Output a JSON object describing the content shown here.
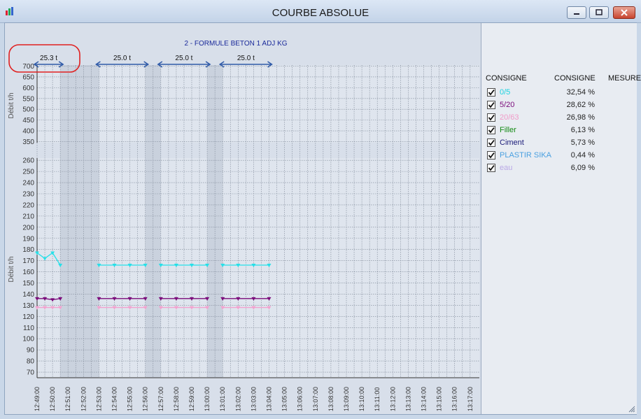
{
  "window": {
    "title": "COURBE ABSOLUE"
  },
  "chart": {
    "title": "2 - FORMULE BETON 1 ADJ KG",
    "top_axis_label": "Débit t/h",
    "bottom_axis_label": "Débit t/h",
    "top_ticks": [
      "350",
      "400",
      "450",
      "500",
      "550",
      "600",
      "650",
      "700"
    ],
    "bottom_ticks": [
      "70",
      "80",
      "90",
      "100",
      "110",
      "120",
      "130",
      "140",
      "150",
      "160",
      "170",
      "180",
      "190",
      "200",
      "210",
      "220",
      "230",
      "240",
      "250",
      "260"
    ],
    "time_labels": [
      "12:49:00",
      "12:50:00",
      "12:51:00",
      "12:52:00",
      "12:53:00",
      "12:54:00",
      "12:55:00",
      "12:56:00",
      "12:57:00",
      "12:58:00",
      "12:59:00",
      "13:00:00",
      "13:01:00",
      "13:02:00",
      "13:03:00",
      "13:04:00",
      "13:05:00",
      "13:06:00",
      "13:07:00",
      "13:08:00",
      "13:09:00",
      "13:10:00",
      "13:11:00",
      "13:12:00",
      "13:13:00",
      "13:14:00",
      "13:15:00",
      "13:16:00",
      "13:17:00"
    ],
    "batches": [
      {
        "label": "25.3 t",
        "start": "12:49:00",
        "end": "12:50:30",
        "highlighted": true
      },
      {
        "label": "25.0 t",
        "start": "12:53:00",
        "end": "12:56:00"
      },
      {
        "label": "25.0 t",
        "start": "12:57:00",
        "end": "13:00:00"
      },
      {
        "label": "25.0 t",
        "start": "13:01:00",
        "end": "13:04:00"
      }
    ],
    "shaded_spans": [
      [
        "12:50:30",
        "12:53:00"
      ],
      [
        "12:56:00",
        "12:57:00"
      ],
      [
        "13:00:00",
        "13:01:00"
      ]
    ],
    "annotation_color": "#e02020",
    "arrow_color": "#2f5aa8"
  },
  "chart_data": {
    "type": "line",
    "x_unit": "time",
    "ylabel": "Débit t/h",
    "ylim": [
      65,
      262
    ],
    "series": [
      {
        "name": "0/5",
        "color": "#26e0e8",
        "segments": [
          [
            [
              "12:49:00",
              177
            ],
            [
              "12:49:30",
              172
            ],
            [
              "12:50:00",
              177
            ],
            [
              "12:50:30",
              166
            ]
          ],
          [
            [
              "12:53:00",
              166
            ],
            [
              "12:54:00",
              166
            ],
            [
              "12:55:00",
              166
            ],
            [
              "12:56:00",
              166
            ]
          ],
          [
            [
              "12:57:00",
              166
            ],
            [
              "12:58:00",
              166
            ],
            [
              "12:59:00",
              166
            ],
            [
              "13:00:00",
              166
            ]
          ],
          [
            [
              "13:01:00",
              166
            ],
            [
              "13:02:00",
              166
            ],
            [
              "13:03:00",
              166
            ],
            [
              "13:04:00",
              166
            ]
          ]
        ]
      },
      {
        "name": "5/20",
        "color": "#7a0a7a",
        "segments": [
          [
            [
              "12:49:00",
              136
            ],
            [
              "12:49:30",
              136
            ],
            [
              "12:50:00",
              135
            ],
            [
              "12:50:30",
              136
            ]
          ],
          [
            [
              "12:53:00",
              136
            ],
            [
              "12:54:00",
              136
            ],
            [
              "12:55:00",
              136
            ],
            [
              "12:56:00",
              136
            ]
          ],
          [
            [
              "12:57:00",
              136
            ],
            [
              "12:58:00",
              136
            ],
            [
              "12:59:00",
              136
            ],
            [
              "13:00:00",
              136
            ]
          ],
          [
            [
              "13:01:00",
              136
            ],
            [
              "13:02:00",
              136
            ],
            [
              "13:03:00",
              136
            ],
            [
              "13:04:00",
              136
            ]
          ]
        ]
      },
      {
        "name": "20/63",
        "color": "#f2a2cf",
        "segments": [
          [
            [
              "12:49:00",
              128
            ],
            [
              "12:49:30",
              128
            ],
            [
              "12:50:00",
              128
            ],
            [
              "12:50:30",
              128
            ]
          ],
          [
            [
              "12:53:00",
              128
            ],
            [
              "12:54:00",
              128
            ],
            [
              "12:55:00",
              128
            ],
            [
              "12:56:00",
              128
            ]
          ],
          [
            [
              "12:57:00",
              128
            ],
            [
              "12:58:00",
              128
            ],
            [
              "12:59:00",
              128
            ],
            [
              "13:00:00",
              128
            ]
          ],
          [
            [
              "13:01:00",
              128
            ],
            [
              "13:02:00",
              128
            ],
            [
              "13:03:00",
              128
            ],
            [
              "13:04:00",
              128
            ]
          ]
        ]
      }
    ]
  },
  "legend": {
    "headers": {
      "col1": "CONSIGNE",
      "col2": "CONSIGNE",
      "col3": "MESURE"
    },
    "items": [
      {
        "name": "0/5",
        "value": "32,54 %",
        "color": "#19d3e0"
      },
      {
        "name": "5/20",
        "value": "28,62 %",
        "color": "#7a0a7a"
      },
      {
        "name": "20/63",
        "value": "26,98 %",
        "color": "#f19ac8"
      },
      {
        "name": "Filler",
        "value": "6,13 %",
        "color": "#138a13"
      },
      {
        "name": "Ciment",
        "value": "5,73 %",
        "color": "#1a1a78"
      },
      {
        "name": "PLASTIR SIKA",
        "value": "0,44 %",
        "color": "#4aa0e0"
      },
      {
        "name": "eau",
        "value": "6,09 %",
        "color": "#b9a8e6"
      }
    ]
  }
}
